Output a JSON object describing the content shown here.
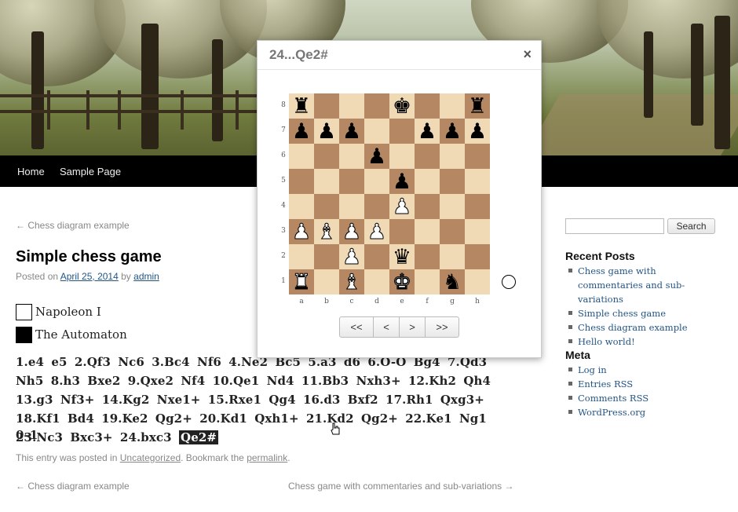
{
  "nav": {
    "home": "Home",
    "sample": "Sample Page"
  },
  "post": {
    "prev_top": "← Chess diagram example",
    "title": "Simple chess game",
    "meta_posted": "Posted on",
    "meta_date": "April 25, 2014",
    "meta_by": "by",
    "meta_author": "admin",
    "white_player": "Napoleon I",
    "black_player": "The Automaton",
    "moves": [
      "1.e4",
      "e5",
      "2.Qf3",
      "Nc6",
      "3.Bc4",
      "Nf6",
      "4.Ne2",
      "Bc5",
      "5.a3",
      "d6",
      "6.O-O",
      "Bg4",
      "7.Qd3",
      "Nh5",
      "8.h3",
      "Bxe2",
      "9.Qxe2",
      "Nf4",
      "10.Qe1",
      "Nd4",
      "11.Bb3",
      "Nxh3+",
      "12.Kh2",
      "Qh4",
      "13.g3",
      "Nf3+",
      "14.Kg2",
      "Nxe1+",
      "15.Rxe1",
      "Qg4",
      "16.d3",
      "Bxf2",
      "17.Rh1",
      "Qxg3+",
      "18.Kf1",
      "Bd4",
      "19.Ke2",
      "Qg2+",
      "20.Kd1",
      "Qxh1+",
      "21.Kd2",
      "Qg2+",
      "22.Ke1",
      "Ng1",
      "23.Nc3",
      "Bxc3+",
      "24.bxc3",
      "Qe2#"
    ],
    "result": "0–1",
    "footer_prefix": "This entry was posted in",
    "footer_category": "Uncategorized",
    "footer_mid": ". Bookmark the",
    "footer_permalink": "permalink",
    "footer_end": ".",
    "bottom_prev": "← Chess diagram example",
    "bottom_next": "Chess game with commentaries and sub-variations →"
  },
  "sidebar": {
    "search_button": "Search",
    "search_value": "",
    "recent_title": "Recent Posts",
    "recent": [
      "Chess game with commentaries and sub-variations",
      "Simple chess game",
      "Chess diagram example",
      "Hello world!"
    ],
    "meta_title": "Meta",
    "meta": [
      "Log in",
      "Entries RSS",
      "Comments RSS",
      "WordPress.org"
    ]
  },
  "modal": {
    "title": "24...Qe2#",
    "close": "×",
    "ranks": [
      "8",
      "7",
      "6",
      "5",
      "4",
      "3",
      "2",
      "1"
    ],
    "files": [
      "a",
      "b",
      "c",
      "d",
      "e",
      "f",
      "g",
      "h"
    ],
    "board": [
      [
        "r",
        "",
        "",
        "",
        "k",
        "",
        "",
        "r"
      ],
      [
        "p",
        "p",
        "p",
        "",
        "",
        "p",
        "p",
        "p"
      ],
      [
        "",
        "",
        "",
        "p",
        "",
        "",
        "",
        ""
      ],
      [
        "",
        "",
        "",
        "",
        "p",
        "",
        "",
        ""
      ],
      [
        "",
        "",
        "",
        "",
        "P",
        "",
        "",
        ""
      ],
      [
        "P",
        "B",
        "P",
        "P",
        "",
        "",
        "",
        ""
      ],
      [
        "",
        "",
        "P",
        "",
        "q",
        "",
        "",
        ""
      ],
      [
        "R",
        "",
        "B",
        "",
        "K",
        "",
        "n",
        ""
      ]
    ],
    "controls": [
      "<<",
      "<",
      ">",
      ">>"
    ],
    "side_to_move": "white"
  }
}
